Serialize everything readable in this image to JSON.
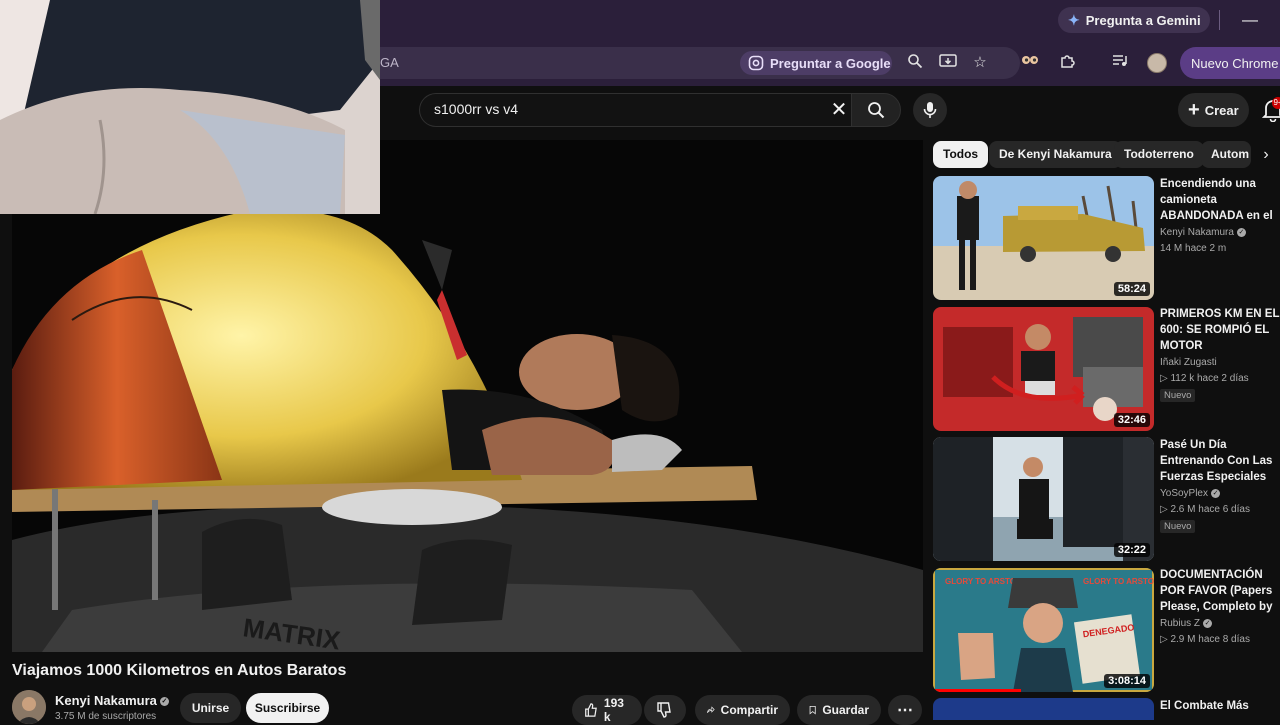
{
  "browser": {
    "gemini_button": "Pregunta a Gemini",
    "url_fragment": "GA",
    "ask_google_button": "Preguntar a Google",
    "new_chrome_button": "Nuevo Chrome d"
  },
  "youtube_header": {
    "search_query": "s1000rr vs v4",
    "create_label": "Crear",
    "notifications_count": "9+"
  },
  "video": {
    "title": "Viajamos 1000 Kilometros en Autos Baratos",
    "channel": "Kenyi Nakamura",
    "subscribers": "3.75 M de suscriptores",
    "join_label": "Unirse",
    "subscribe_label": "Suscribirse",
    "likes": "193 k",
    "share_label": "Compartir",
    "save_label": "Guardar"
  },
  "chips": [
    "Todos",
    "De Kenyi Nakamura",
    "Todoterreno",
    "Autom"
  ],
  "related": [
    {
      "title": "Encendiendo una camioneta ABANDONADA en el ...",
      "channel": "Kenyi Nakamura",
      "stats": "14 M   hace 2 m",
      "duration": "58:24",
      "badge": ""
    },
    {
      "title": "PRIMEROS KM EN EL 600: SE ROMPIÓ EL MOTOR",
      "channel": "Iñaki Zugasti",
      "stats": "112 k   hace 2 días",
      "duration": "32:46",
      "badge": "Nuevo"
    },
    {
      "title": "Pasé Un Día Entrenando Con Las Fuerzas Especiales De España",
      "channel": "YoSoyPlex",
      "stats": "2.6 M   hace 6 días",
      "duration": "32:22",
      "badge": "Nuevo"
    },
    {
      "title": "DOCUMENTACIÓN POR FAVOR (Papers Please, Completo by Rubius)",
      "channel": "Rubius Z",
      "stats": "2.9 M   hace 8 días",
      "duration": "3:08:14",
      "badge": ""
    },
    {
      "title": "El Combate Más",
      "channel": "",
      "stats": "",
      "duration": "",
      "badge": ""
    }
  ],
  "thumbnail_texts": {
    "glory_left": "GLORY TO ARSTOTZKA",
    "glory_right": "GLORY TO ARSTOTZKA",
    "stamp": "DENEGADO"
  },
  "colors": {
    "background": "#0f0f0f",
    "browser_frame": "#2b1f3a",
    "accent_purple": "#5b3d86",
    "chip_active": "#f1f1f1",
    "chip": "#272727"
  },
  "watch_progress": {
    "related_3": 0.4
  }
}
